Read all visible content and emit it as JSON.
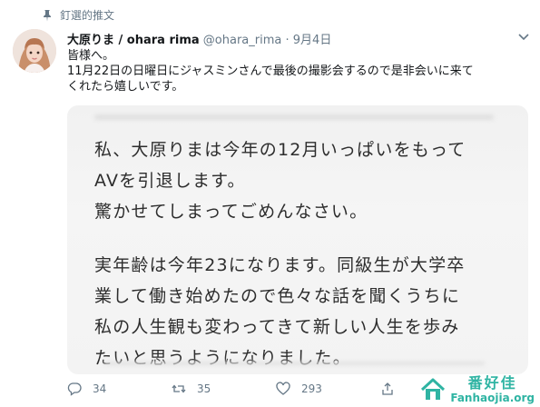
{
  "pinned": {
    "label": "釘選的推文",
    "icon": "pin-icon"
  },
  "author": {
    "display_name": "大原りま / ohara rima",
    "handle": "@ohara_rima",
    "separator": "·",
    "date": "9月4日"
  },
  "tweet": {
    "lines": [
      "皆様へ。",
      "11月22日の日曜日にジャスミンさんで最後の撮影会するので是非会いに来て",
      "くれたら嬉しいです。"
    ]
  },
  "media": {
    "lines": [
      "私、大原りまは今年の12月いっぱいをもって",
      "AVを引退します。",
      "驚かせてしまってごめんなさい。",
      "",
      "実年齢は今年23になります。同級生が大学卒",
      "業して働き始めたので色々な話を聞くうちに",
      "私の人生観も変わってきて新しい人生を歩み",
      "たいと思うようになりました。"
    ]
  },
  "actions": {
    "reply_count": "34",
    "retweet_count": "35",
    "like_count": "293"
  },
  "watermark": {
    "cn": "番好佳",
    "en": "Fanhaojia.org",
    "color": "#2fb4a3"
  }
}
